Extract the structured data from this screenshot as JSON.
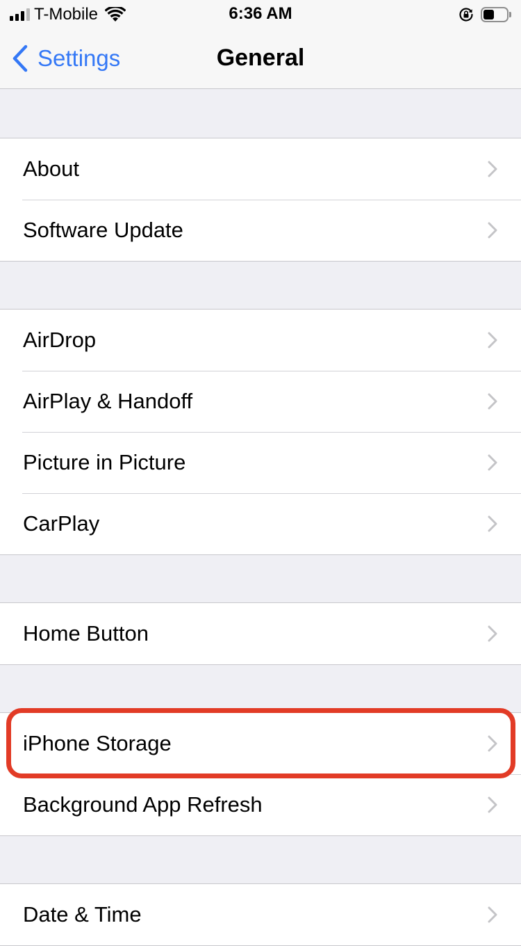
{
  "status_bar": {
    "carrier": "T-Mobile",
    "time": "6:36 AM",
    "icons": [
      "signal-icon",
      "wifi-icon",
      "rotation-lock-icon",
      "battery-icon"
    ],
    "battery_level": 0.35
  },
  "navbar": {
    "back_label": "Settings",
    "title": "General"
  },
  "groups": [
    {
      "items": [
        {
          "label": "About"
        },
        {
          "label": "Software Update"
        }
      ]
    },
    {
      "items": [
        {
          "label": "AirDrop"
        },
        {
          "label": "AirPlay & Handoff"
        },
        {
          "label": "Picture in Picture"
        },
        {
          "label": "CarPlay"
        }
      ]
    },
    {
      "items": [
        {
          "label": "Home Button"
        }
      ]
    },
    {
      "items": [
        {
          "label": "iPhone Storage",
          "highlighted": true
        },
        {
          "label": "Background App Refresh"
        }
      ]
    },
    {
      "items": [
        {
          "label": "Date & Time"
        }
      ]
    }
  ],
  "colors": {
    "accent": "#3478f6",
    "highlight": "#e23b26",
    "background": "#efeff4"
  }
}
